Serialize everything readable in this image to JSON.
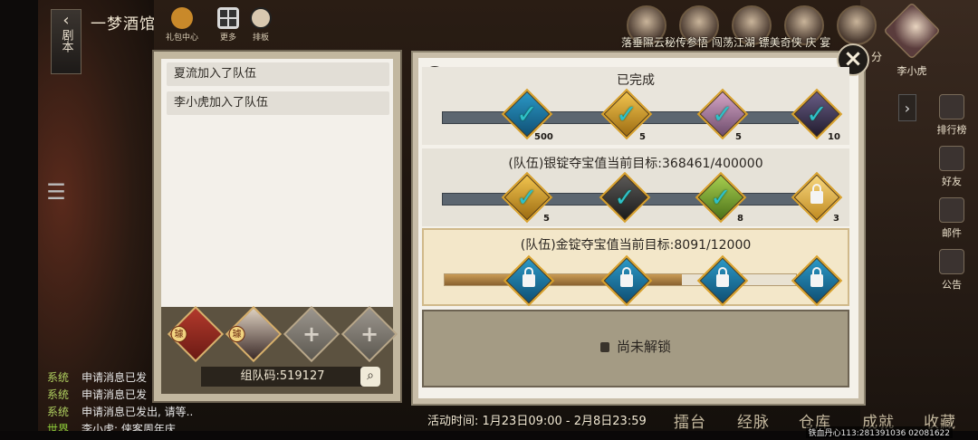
{
  "topbar": {
    "back_label": "剧本",
    "title": "一梦酒馆",
    "icons": [
      {
        "name": "gift-center",
        "label": "礼包中心"
      },
      {
        "name": "more",
        "label": "更多"
      },
      {
        "name": "ranking",
        "label": "排板"
      }
    ]
  },
  "heroes_caption": "落垂隰云秘传参悟 闯荡江湖 镖美奇侠 庆 宴",
  "score_suffix": "分",
  "player": {
    "name": "李小虎"
  },
  "side_menu": [
    {
      "name": "ranking",
      "label": "排行榜"
    },
    {
      "name": "friends",
      "label": "好友"
    },
    {
      "name": "mail",
      "label": "邮件"
    },
    {
      "name": "notice",
      "label": "公告"
    }
  ],
  "team_panel": {
    "messages": [
      "夏流加入了队伍",
      "李小虎加入了队伍"
    ],
    "leader_badge": "璩",
    "member_badge": "璩",
    "team_code": "组队码:519127"
  },
  "main_panel": {
    "tier1": {
      "title": "已完成",
      "nodes": [
        {
          "icon": "blue-crystal",
          "count": "500",
          "status": "done"
        },
        {
          "icon": "gold-chest",
          "count": "5",
          "status": "done"
        },
        {
          "icon": "pink-gem",
          "count": "5",
          "status": "done"
        },
        {
          "icon": "dark-relic",
          "count": "10",
          "status": "done"
        }
      ]
    },
    "tier2": {
      "title": "(队伍)银锭夺宝值当前目标:368461/400000",
      "progress": 0.921,
      "nodes": [
        {
          "icon": "gold-chest",
          "count": "5",
          "status": "done"
        },
        {
          "icon": "iron-hammer",
          "count": "",
          "status": "done"
        },
        {
          "icon": "green-herb",
          "count": "8",
          "status": "done"
        },
        {
          "icon": "gold-lock",
          "count": "3",
          "status": "locked"
        }
      ]
    },
    "tier3": {
      "title": "(队伍)金锭夺宝值当前目标:8091/12000",
      "progress": 0.674,
      "nodes": [
        {
          "icon": "blue-lock",
          "status": "locked"
        },
        {
          "icon": "blue-lock",
          "status": "locked"
        },
        {
          "icon": "blue-lock",
          "status": "locked"
        },
        {
          "icon": "blue-lock",
          "status": "locked"
        }
      ]
    },
    "tier4": {
      "label": "尚未解锁"
    }
  },
  "chat": [
    {
      "channel": "系统",
      "text": "申请消息已发"
    },
    {
      "channel": "系统",
      "text": "申请消息已发"
    },
    {
      "channel": "系统",
      "text": "申请消息已发出, 请等.."
    },
    {
      "channel": "世界",
      "text": "李小虎: 侠客周年庆.."
    }
  ],
  "event_time": "活动时间: 1月23日09:00 - 2月8日23:59",
  "bottom_tabs": [
    "擂台",
    "经脉",
    "仓库",
    "成就",
    "收藏"
  ],
  "server_info": "铁血丹心113:281391036 02081622",
  "colors": {
    "panel_border": "#6d6352",
    "accent_gold": "#d8a02a",
    "check_teal": "#2fc0c8",
    "chat_channel": "#b0d060"
  }
}
